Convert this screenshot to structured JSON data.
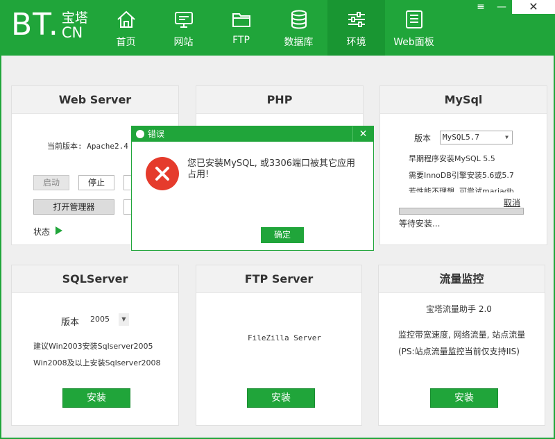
{
  "app": {
    "logo_main": "BT.",
    "logo_top": "宝塔",
    "logo_bottom": "CN"
  },
  "window_controls": {
    "menu": "≡",
    "minimize": "—",
    "close": "✕"
  },
  "nav": [
    {
      "label": "首页",
      "icon": "home-icon"
    },
    {
      "label": "网站",
      "icon": "monitor-icon"
    },
    {
      "label": "FTP",
      "icon": "folder-icon"
    },
    {
      "label": "数据库",
      "icon": "database-icon"
    },
    {
      "label": "环境",
      "icon": "sliders-icon",
      "active": true
    },
    {
      "label": "Web面板",
      "icon": "panel-icon"
    }
  ],
  "webserver": {
    "title": "Web Server",
    "version_text": "当前版本: Apache2.4",
    "start_label": "启动",
    "stop_label": "停止",
    "manager_label": "打开管理器",
    "status_label": "状态"
  },
  "php": {
    "title": "PHP"
  },
  "mysql": {
    "title": "MySql",
    "version_label": "版本",
    "version_value": "MySQL5.7",
    "note1": "早期程序安装MySQL 5.5",
    "note2": "需要InnoDB引擎安装5.6或5.7",
    "note3": "若性能不理想, 可尝试mariadb",
    "cancel_label": "取消",
    "waiting_label": "等待安装..."
  },
  "sqlserver": {
    "title": "SQLServer",
    "version_label": "版本",
    "version_value": "2005",
    "note1": "建议Win2003安装Sqlserver2005",
    "note2": "Win2008及以上安装Sqlserver2008",
    "install_label": "安装"
  },
  "ftpserver": {
    "title": "FTP Server",
    "product": "FileZilla Server",
    "install_label": "安装"
  },
  "traffic": {
    "title": "流量监控",
    "product": "宝塔流量助手 2.0",
    "description": "监控带宽速度, 网络流量, 站点流量(PS:站点流量监控当前仅支持IIS)",
    "install_label": "安装"
  },
  "dialog": {
    "title": "错误",
    "close": "✕",
    "message": "您已安装MySQL, 或3306端口被其它应用占用!",
    "ok_label": "确定"
  },
  "colors": {
    "brand": "#20a53a",
    "brand_dark": "#199632",
    "error": "#e53b2c",
    "background": "#efefef"
  }
}
